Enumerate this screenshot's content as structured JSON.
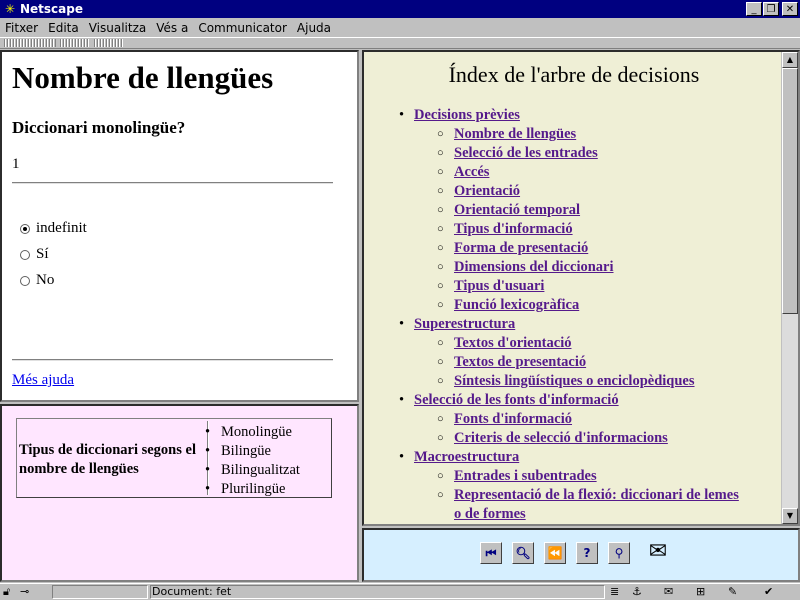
{
  "window": {
    "title": "Netscape"
  },
  "menu": [
    "Fitxer",
    "Edita",
    "Visualitza",
    "Vés a",
    "Communicator",
    "Ajuda"
  ],
  "left_top": {
    "title": "Nombre de llengües",
    "question": "Diccionari monolingüe?",
    "number": "1",
    "options": [
      {
        "label": "indefinit",
        "selected": true
      },
      {
        "label": "Sí",
        "selected": false
      },
      {
        "label": "No",
        "selected": false
      }
    ],
    "help_link": "Més ajuda"
  },
  "left_bottom": {
    "label": "Tipus de diccionari segons el nombre de llengües",
    "types": [
      "Monolingüe",
      "Bilingüe",
      "Bilingualitzat",
      "Plurilingüe"
    ]
  },
  "index": {
    "title": "Índex de l'arbre de decisions",
    "items": [
      {
        "label": "Decisions prèvies",
        "level": 1
      },
      {
        "label": "Nombre de llengües",
        "level": 2
      },
      {
        "label": "Selecció de les entrades",
        "level": 2
      },
      {
        "label": "Accés",
        "level": 2
      },
      {
        "label": "Orientació",
        "level": 2
      },
      {
        "label": "Orientació temporal",
        "level": 2
      },
      {
        "label": "Tipus d'informació",
        "level": 2
      },
      {
        "label": "Forma de presentació",
        "level": 2
      },
      {
        "label": "Dimensions del diccionari",
        "level": 2
      },
      {
        "label": "Tipus d'usuari",
        "level": 2
      },
      {
        "label": "Funció lexicogràfica",
        "level": 2
      },
      {
        "label": "Superestructura",
        "level": 1
      },
      {
        "label": "Textos d'orientació",
        "level": 2
      },
      {
        "label": "Textos de presentació",
        "level": 2
      },
      {
        "label": "Síntesis lingüístiques o enciclopèdiques",
        "level": 2
      },
      {
        "label": "Selecció de les fonts d'informació",
        "level": 1
      },
      {
        "label": "Fonts d'informació",
        "level": 2
      },
      {
        "label": "Criteris de selecció d'informacions",
        "level": 2
      },
      {
        "label": "Macroestructura",
        "level": 1
      },
      {
        "label": "Entrades i subentrades",
        "level": 2
      },
      {
        "label": "Representació de la flexió: diccionari de lemes",
        "level": 2
      },
      {
        "label": "o de formes",
        "level": 2,
        "continuation": true
      }
    ]
  },
  "nav_buttons": [
    "first-icon",
    "find-icon",
    "back-icon",
    "help-icon",
    "search-icon",
    "mail-icon"
  ],
  "status": {
    "text": "Document: fet"
  },
  "colors": {
    "titlebar": "#000080",
    "index_bg": "#efefd6",
    "left_bottom_bg": "#ffe6ff",
    "nav_bg": "#d6efff",
    "link": "#551a8b"
  }
}
